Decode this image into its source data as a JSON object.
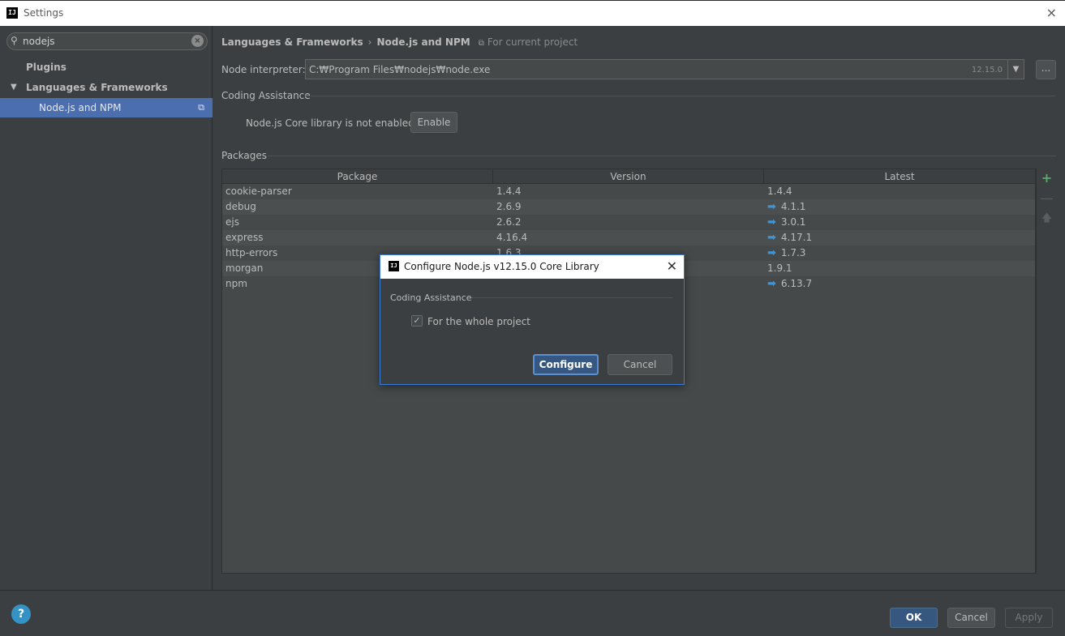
{
  "window": {
    "app_icon": "IJ",
    "title": "Settings",
    "close_glyph": "×"
  },
  "sidebar": {
    "search_value": "nodejs",
    "items": [
      {
        "label": "Plugins"
      },
      {
        "label": "Languages & Frameworks"
      },
      {
        "label": "Node.js and NPM"
      }
    ]
  },
  "breadcrumb": {
    "part1": "Languages & Frameworks",
    "separator": "›",
    "part2": "Node.js and NPM",
    "scope": "For current project"
  },
  "interpreter": {
    "label": "Node interpreter:",
    "path": "C:₩Program Files₩nodejs₩node.exe",
    "version": "12.15.0",
    "browse_label": "..."
  },
  "coding_assistance": {
    "title": "Coding Assistance",
    "message": "Node.js Core library is not enabled.",
    "enable_label": "Enable"
  },
  "packages": {
    "title": "Packages",
    "columns": [
      "Package",
      "Version",
      "Latest"
    ],
    "rows": [
      {
        "package": "cookie-parser",
        "version": "1.4.4",
        "latest": "1.4.4",
        "update": false
      },
      {
        "package": "debug",
        "version": "2.6.9",
        "latest": "4.1.1",
        "update": true
      },
      {
        "package": "ejs",
        "version": "2.6.2",
        "latest": "3.0.1",
        "update": true
      },
      {
        "package": "express",
        "version": "4.16.4",
        "latest": "4.17.1",
        "update": true
      },
      {
        "package": "http-errors",
        "version": "1.6.3",
        "latest": "1.7.3",
        "update": true
      },
      {
        "package": "morgan",
        "version": "",
        "latest": "1.9.1",
        "update": false
      },
      {
        "package": "npm",
        "version": "",
        "latest": "6.13.7",
        "update": true
      }
    ]
  },
  "bottom": {
    "help": "?",
    "ok": "OK",
    "cancel": "Cancel",
    "apply": "Apply"
  },
  "modal": {
    "title": "Configure Node.js v12.15.0 Core Library",
    "section": "Coding Assistance",
    "checkbox_label": "For the whole project",
    "checkbox_checked": true,
    "configure": "Configure",
    "cancel": "Cancel"
  },
  "colors": {
    "accent": "#4b6eaf",
    "primary_button": "#365880",
    "update_arrow": "#3e96d8",
    "add_icon": "#59a869"
  }
}
